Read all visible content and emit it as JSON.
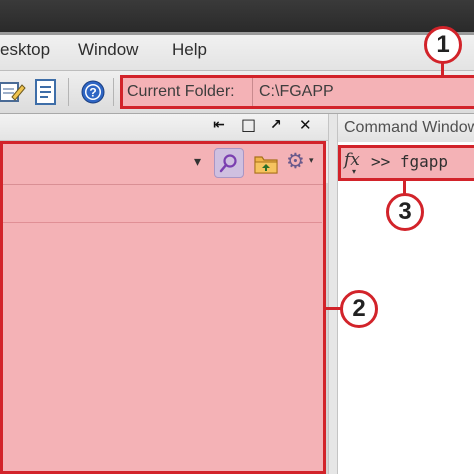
{
  "menubar": {
    "items": [
      {
        "label": "esktop"
      },
      {
        "label": "Window"
      },
      {
        "label": "Help"
      }
    ]
  },
  "toolbar": {
    "current_folder_label": "Current Folder:",
    "current_folder_value": "C:\\FGAPP",
    "icons": [
      "edit-document-icon",
      "document-icon",
      "help-icon"
    ]
  },
  "current_folder_panel": {
    "controls": [
      "⇤",
      "□",
      "↗",
      "✕"
    ],
    "dropdown_glyph": "▾",
    "settings_glyph": "⚙"
  },
  "command_window": {
    "title": "Command Window",
    "function_glyph": "fx",
    "prompt": ">> fgapp"
  },
  "callouts": [
    {
      "number": "1"
    },
    {
      "number": "2"
    },
    {
      "number": "3"
    }
  ],
  "colors": {
    "highlight_fill": "#f4b2b6",
    "highlight_border": "#d2232a"
  }
}
